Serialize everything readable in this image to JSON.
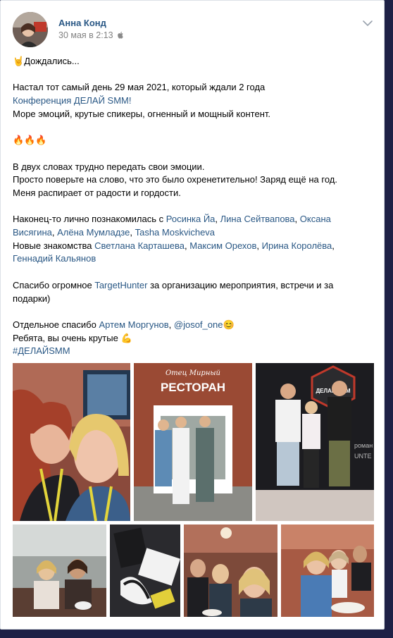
{
  "author": {
    "name": "Анна Конд",
    "date": "30 мая в 2:13"
  },
  "icons": {
    "device": "apple-icon",
    "menu": "chevron-down-icon"
  },
  "post": {
    "line1": "Дождались...",
    "line2": "Настал тот самый день 29 мая 2021, который ждали 2 года",
    "line3_link": "Конференция ДЕЛАЙ SMM!",
    "line4": "Море эмоций, крутые спикеры, огненный и мощный контент.",
    "fire": "🔥🔥🔥",
    "rock": "🤘",
    "line5": "В двух словах трудно передать свои эмоции.",
    "line6": "Просто поверьте на слово, что это было охренетительно! Заряд ещё на год.",
    "line7": "Меня распирает от радости и гордости.",
    "met_prefix": "Наконец-то лично познакомилась с ",
    "met_links": [
      "Росинка Йа",
      "Лина Сейтвапова",
      "Оксана Висягина",
      "Алёна Мумладзе",
      "Tasha Moskvicheva"
    ],
    "new_prefix": "Новые знакомства ",
    "new_links": [
      "Светлана Карташева",
      "Максим Орехов",
      "Ирина Королёва",
      "Геннадий Кальянов"
    ],
    "thanks_prefix": "Спасибо огромное ",
    "thanks_link": "TargetHunter",
    "thanks_suffix": " за организацию мероприятия, встречи и за подарки)",
    "special_prefix": "Отдельное спасибо ",
    "special_link1": "Артем Моргунов",
    "special_link2": "@josof_one",
    "smile": "😊",
    "cool": "Ребята, вы очень крутые ",
    "muscle": "💪",
    "hashtag": "#ДЕЛАЙSMM"
  },
  "photos": {
    "p2_sign_top": "Отец Мирный",
    "p2_sign": "РЕСТОРАН",
    "p3_banner": "ДЕЛАЙ SMM",
    "p3_wall1": "роман",
    "p3_wall2": "UNTE"
  },
  "colors": {
    "link": "#2a5885",
    "page_bg": "#1e2146"
  }
}
